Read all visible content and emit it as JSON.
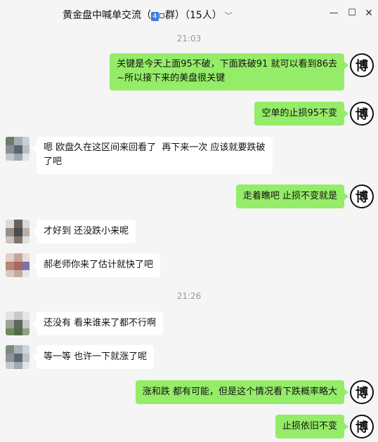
{
  "window": {
    "title_prefix": "黄金盘中喊单交流（",
    "title_badge": "4",
    "title_suffix": "▫群）（15人）",
    "chevron": "﹀"
  },
  "timestamps": [
    "21:03",
    "21:26"
  ],
  "messages": [
    {
      "side": "right",
      "text": "关键是今天上面95不破，下面跌破91 就可以看到86去\n~所以接下来的美盘很关键"
    },
    {
      "side": "right",
      "text": "空单的止损95不变"
    },
    {
      "side": "left",
      "text": "嗯 欧盘久在这区间来回看了  再下来一次 应该就要跌破\n了吧"
    },
    {
      "side": "right",
      "text": "走着瞧吧  止损不变就是"
    },
    {
      "side": "left",
      "text": "才好到 还没跌小来呢"
    },
    {
      "side": "left",
      "text": "郝老师你来了估计就快了吧"
    },
    {
      "side": "left",
      "text": "还没有  看来谁来了都不行啊"
    },
    {
      "side": "left",
      "text": "等一等 也许一下就涨了呢"
    },
    {
      "side": "right",
      "text": "涨和跌 都有可能，但是这个情况看下跌概率略大"
    },
    {
      "side": "right",
      "text": "止损依旧不变"
    }
  ],
  "avatar_glyph": "博",
  "colors": {
    "self_bubble": "#95ec69",
    "other_bubble": "#ffffff",
    "background": "#f5f5f5"
  },
  "icons": {
    "minimize": "minimize-icon",
    "maximize": "maximize-icon",
    "close": "close-icon"
  }
}
